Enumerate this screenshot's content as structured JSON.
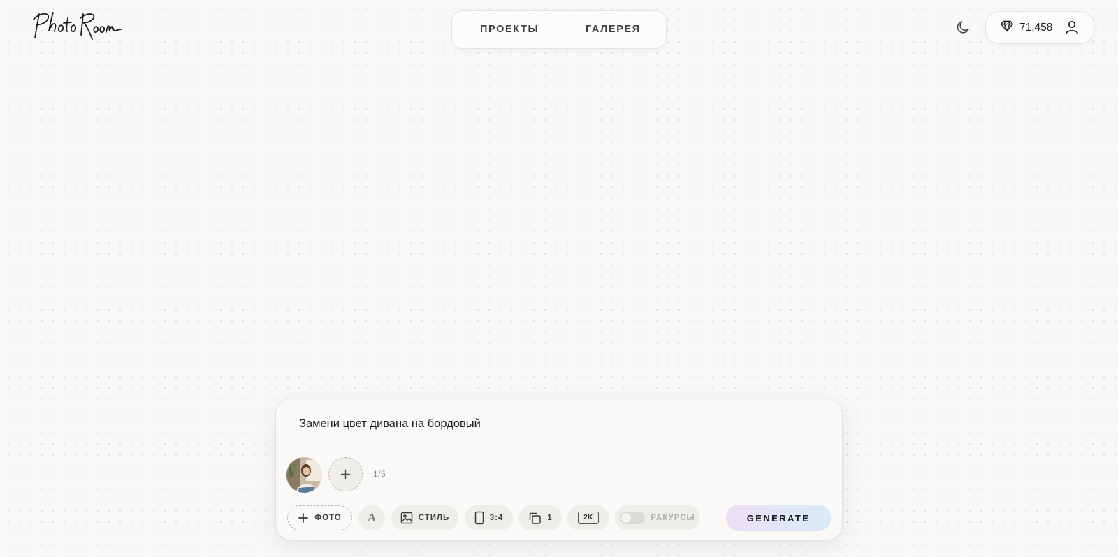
{
  "header": {
    "logo_text": "Photo Room",
    "nav": [
      {
        "label": "ПРОЕКТЫ"
      },
      {
        "label": "ГАЛЕРЕЯ"
      }
    ],
    "theme_icon": "moon-icon",
    "credits": {
      "icon": "diamond-icon",
      "value": "71,458"
    },
    "profile_icon": "user-icon"
  },
  "composer": {
    "prompt_text": "Замени цвет дивана на бордовый",
    "reference_count": "1/5",
    "toolbar": {
      "add_photo_label": "ФОТО",
      "font_label": "A",
      "style_label": "СТИЛЬ",
      "aspect_ratio": "3:4",
      "variations": "1",
      "resolution": "2K",
      "angles_label": "РАКУРСЫ",
      "angles_enabled": false
    },
    "generate_label": "GENERATE"
  },
  "colors": {
    "background": "#f9f8f6",
    "dot_grid": "#e2e0dc",
    "generate_gradient_start": "#ecdff6",
    "generate_gradient_end": "#d8eaf8"
  }
}
